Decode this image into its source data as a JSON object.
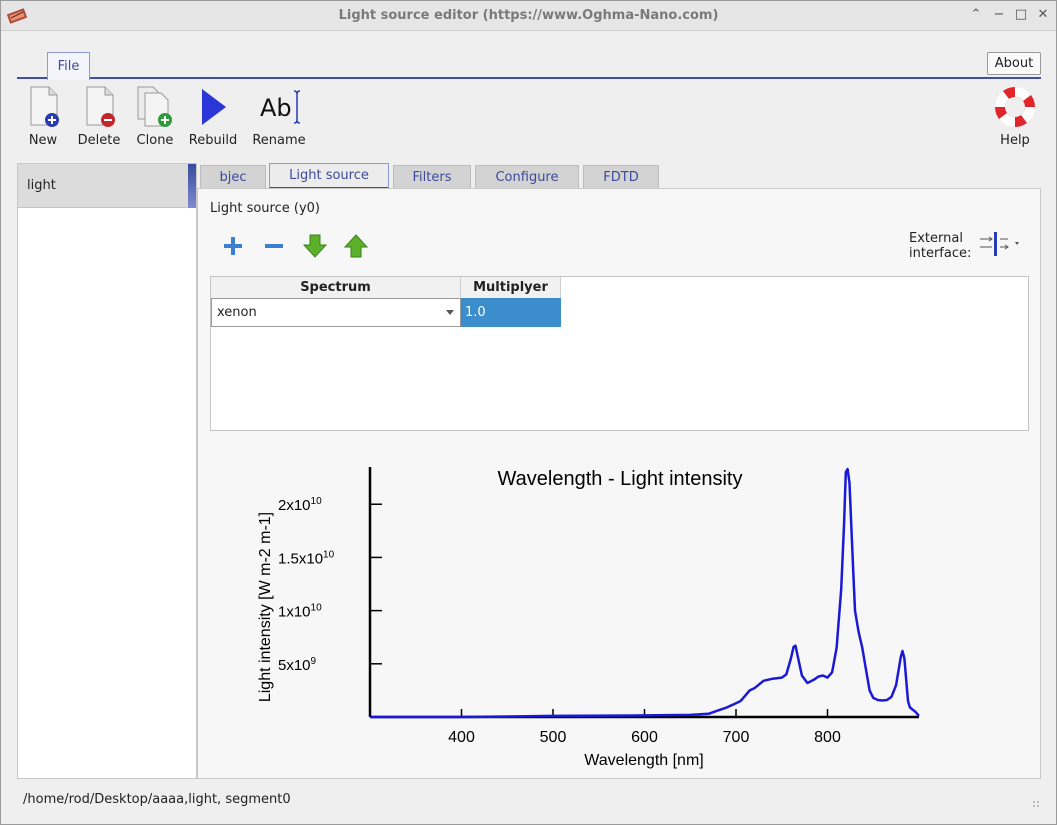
{
  "window": {
    "title": "Light source editor (https://www.Oghma-Nano.com)"
  },
  "menu": {
    "file_tab": "File",
    "about": "About"
  },
  "toolbar": {
    "new": "New",
    "delete": "Delete",
    "clone": "Clone",
    "rebuild": "Rebuild",
    "rename": "Rename",
    "rename_icon_text": "Ab",
    "help": "Help"
  },
  "left_list": {
    "items": [
      "light"
    ]
  },
  "tabs": [
    "bjec",
    "Light source",
    "Filters",
    "Configure",
    "FDTD"
  ],
  "panel": {
    "title": "Light source (y0)",
    "external_interface_line1": "External",
    "external_interface_line2": "interface:",
    "table": {
      "headers": [
        "Spectrum",
        "Multiplyer"
      ],
      "rows": [
        {
          "spectrum": "xenon",
          "multiplyer": "1.0"
        }
      ]
    }
  },
  "chart_data": {
    "type": "line",
    "title": "Wavelength - Light intensity",
    "xlabel": "Wavelength [nm]",
    "ylabel": "Light intensity [W m-2 m-1]",
    "xlim": [
      300,
      900
    ],
    "ylim": [
      0,
      23500000000.0
    ],
    "xticks": [
      400,
      500,
      600,
      700,
      800
    ],
    "yticks": [
      {
        "value": 5000000000.0,
        "base": "5x10",
        "exp": "9"
      },
      {
        "value": 10000000000.0,
        "base": "1x10",
        "exp": "10"
      },
      {
        "value": 15000000000.0,
        "base": "1.5x10",
        "exp": "10"
      },
      {
        "value": 20000000000.0,
        "base": "2x10",
        "exp": "10"
      }
    ],
    "grid": false,
    "color": "#1a1ad6",
    "x": [
      300,
      400,
      450,
      500,
      600,
      650,
      670,
      680,
      690,
      700,
      705,
      710,
      715,
      720,
      730,
      740,
      750,
      755,
      760,
      763,
      765,
      768,
      772,
      778,
      785,
      790,
      795,
      800,
      805,
      810,
      815,
      818,
      820,
      822,
      824,
      826,
      828,
      830,
      834,
      838,
      842,
      846,
      850,
      855,
      860,
      865,
      870,
      875,
      880,
      882,
      884,
      886,
      888,
      890,
      893,
      896,
      900
    ],
    "y": [
      0,
      0,
      50000000.0,
      100000000.0,
      150000000.0,
      200000000.0,
      300000000.0,
      600000000.0,
      900000000.0,
      1300000000.0,
      1500000000.0,
      2000000000.0,
      2500000000.0,
      2700000000.0,
      3400000000.0,
      3600000000.0,
      3700000000.0,
      4000000000.0,
      5500000000.0,
      6600000000.0,
      6700000000.0,
      5500000000.0,
      3900000000.0,
      3200000000.0,
      3500000000.0,
      3800000000.0,
      3900000000.0,
      3700000000.0,
      4200000000.0,
      6500000000.0,
      12000000000.0,
      18000000000.0,
      23000000000.0,
      23300000000.0,
      22000000000.0,
      18000000000.0,
      14000000000.0,
      10000000000.0,
      8000000000.0,
      6500000000.0,
      4500000000.0,
      2500000000.0,
      1800000000.0,
      1600000000.0,
      1550000000.0,
      1600000000.0,
      1900000000.0,
      3000000000.0,
      5600000000.0,
      6200000000.0,
      5500000000.0,
      3500000000.0,
      1500000000.0,
      900000000.0,
      700000000.0,
      500000000.0,
      100000000.0
    ]
  },
  "status": {
    "path": "/home/rod/Desktop/aaaa,light, segment0"
  }
}
